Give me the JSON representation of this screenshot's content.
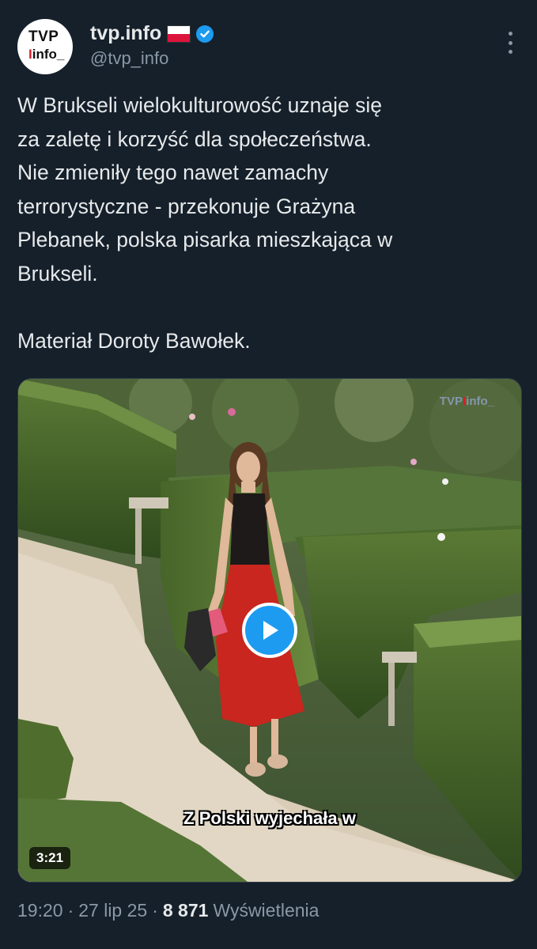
{
  "author": {
    "avatar_line1": "TVP",
    "avatar_line2_bar": "I",
    "avatar_line2_text": "info_",
    "display_name": "tvp.info",
    "flag_icon": "poland-flag-icon",
    "verified_icon": "verified-badge-icon",
    "handle": "@tvp_info"
  },
  "tweet": {
    "lines": [
      "W Brukseli wielokulturowość uznaje się",
      "za zaletę i korzyść dla społeczeństwa.",
      "Nie zmieniły tego nawet zamachy",
      "terrorystyczne - przekonuje Grażyna",
      "Plebanek, polska pisarka mieszkająca w",
      "Brukseli."
    ],
    "credit": "Materiał Doroty Bawołek."
  },
  "media": {
    "watermark_pre": "TVP",
    "watermark_bar": "I",
    "watermark_post": "info_",
    "subtitle": "Z Polski wyjechała w",
    "duration": "3:21",
    "play_icon": "play-icon"
  },
  "meta": {
    "time": "19:20",
    "sep1": "·",
    "date": "27 lip 25",
    "sep2": "·",
    "views_count": "8 871",
    "views_label": "Wyświetlenia"
  },
  "colors": {
    "background": "#15202b",
    "accent": "#1d9bf0",
    "text": "#e7e9ea",
    "muted": "#8b98a5"
  }
}
